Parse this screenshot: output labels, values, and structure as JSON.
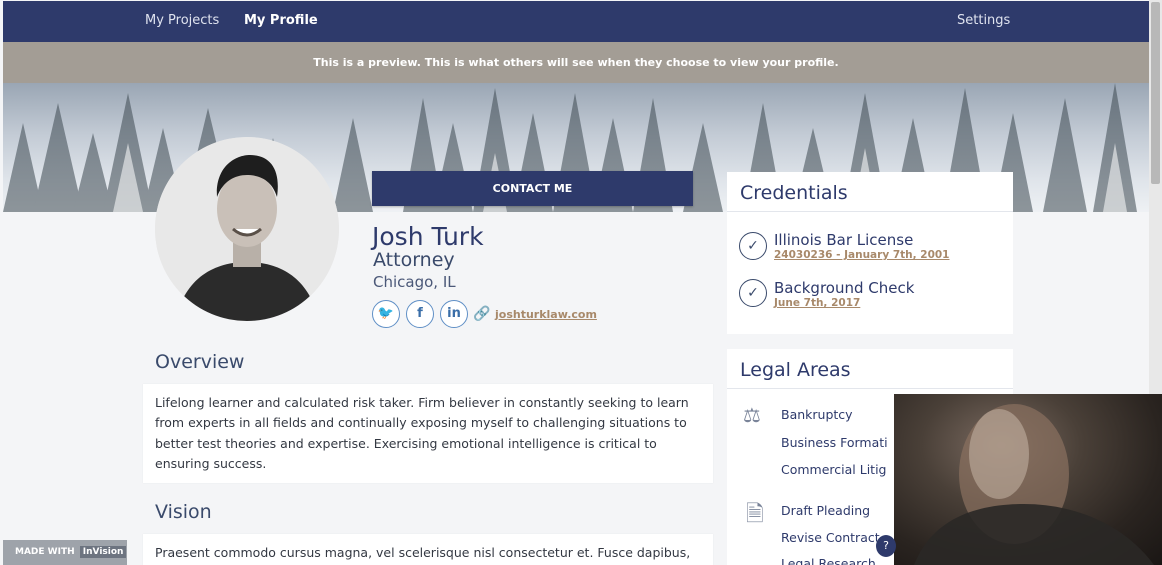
{
  "nav": {
    "items": [
      {
        "label": "My Projects"
      },
      {
        "label": "My Profile",
        "active": true
      },
      {
        "label": "Settings"
      }
    ]
  },
  "preview_notice": "This is a preview. This is what others will see when they choose to view your profile.",
  "profile": {
    "contact_button": "CONTACT ME",
    "name": "Josh Turk",
    "role": "Attorney",
    "location": "Chicago, IL",
    "social": [
      {
        "icon": "twitter-icon",
        "glyph": "🐦"
      },
      {
        "icon": "facebook-icon",
        "glyph": "f"
      },
      {
        "icon": "linkedin-icon",
        "glyph": "in"
      }
    ],
    "website": "joshturklaw.com"
  },
  "overview": {
    "title": "Overview",
    "text": "Lifelong learner and calculated risk taker. Firm believer in constantly seeking to learn from experts in all fields and continually exposing myself to challenging situations to better test theories and expertise. Exercising emotional intelligence is critical to ensuring success."
  },
  "vision": {
    "title": "Vision",
    "text": "Praesent commodo cursus magna, vel scelerisque nisl consectetur et. Fusce dapibus,"
  },
  "credentials": {
    "title": "Credentials",
    "items": [
      {
        "title": "Illinois Bar License",
        "detail": "24030236 - January 7th, 2001"
      },
      {
        "title": "Background Check",
        "detail": "June 7th, 2017"
      }
    ]
  },
  "legal_areas": {
    "title": "Legal Areas",
    "groups": [
      {
        "icon": "scales-icon",
        "items": [
          "Bankruptcy",
          "Business Formati",
          "Commercial Litig"
        ]
      },
      {
        "icon": "document-icon",
        "items": [
          "Draft Pleading",
          "Revise Contract",
          "Legal Research"
        ]
      }
    ]
  },
  "footer": {
    "made_with": "MADE WITH",
    "brand": "InVision"
  },
  "help_label": "?",
  "colors": {
    "nav": "#2e3a6b",
    "preview_bar": "#a39d95",
    "accent_link": "#a8896a"
  }
}
